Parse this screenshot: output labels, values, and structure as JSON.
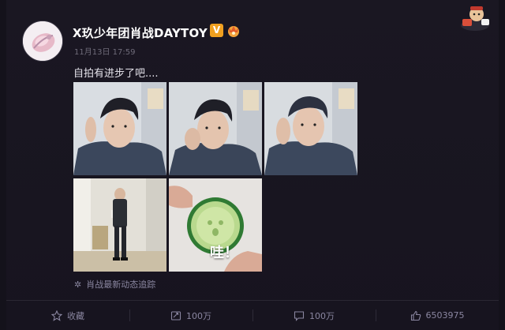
{
  "post": {
    "user_name": "X玖少年团肖战DAYTOY",
    "vip_label": "V",
    "timestamp": "11月13日 17:59",
    "text": "自拍有进步了吧....",
    "photo_caption": "哇！",
    "topic": "肖战最新动态追踪"
  },
  "actions": {
    "favorite_label": "收藏",
    "repost_count": "100万",
    "comment_count": "100万",
    "like_count": "6503975"
  },
  "colors": {
    "background": "#14121b",
    "vip": "#f0a020",
    "muted": "#8a86a0"
  }
}
